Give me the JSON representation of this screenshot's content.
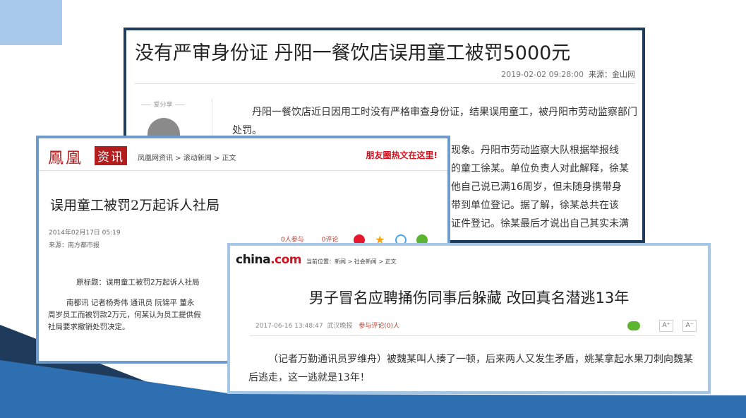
{
  "colors": {
    "accent_light": "#a9c9ea",
    "accent_dark": "#1f3b5c",
    "ifeng_red": "#b31d1d"
  },
  "panel1": {
    "title": "没有严审身份证 丹阳一餐饮店误用童工被罚5000元",
    "datetime": "2019-02-02 09:28:00",
    "source_label": "来源：金山网",
    "share_label": "爱分享",
    "share_icon": "wechat-icon",
    "paragraphs": [
      "丹阳一餐饮店近日因用工时没有严格审查身份证，结果误用童工，被丹阳市劳动监察部门处罚。",
      "现象。丹阳市劳动监察大队根据举报线",
      "的童工徐某。单位负责人对此解释，徐某",
      "他自己说已满16周岁，但未随身携带身",
      "带到单位登记。据了解，徐某总共在该",
      "证件登记。徐某最后才说出自己其实未满"
    ]
  },
  "panel2": {
    "logo_text": "鳳凰",
    "logo_box": "资讯",
    "breadcrumb": "凤凰网资讯 > 滚动新闻 > 正文",
    "promo": "朋友圈热文在这里!",
    "title": "误用童工被罚2万起诉人社局",
    "date": "2014年02月17日 05:19",
    "source": "来源：南方都市报",
    "likes": "0人参与",
    "comments": "0评论",
    "paragraphs": [
      "原标题：误用童工被罚2万起诉人社局",
      "南都讯 记者杨秀伟 通讯员 阮锦平 董永",
      "周岁员工而被罚款2万元，何某认为员工提供假",
      "社局要求撤销处罚决定。"
    ]
  },
  "panel3": {
    "logo": "china",
    "logo_suffix": ".com",
    "breadcrumb": "当前位置：新闻 > 社会新闻 > 正文",
    "title": "男子冒名应聘捅伤同事后躲藏 改回真名潜逃13年",
    "datetime": "2017-06-16 13:48:47",
    "source": "武汉晚报",
    "comments": "参与评论(0)人",
    "font_plus": "A⁺",
    "font_minus": "A⁻",
    "body": "（记者万勤通讯员罗维舟）被魏某叫人揍了一顿，后来两人又发生矛盾，姚某拿起水果刀刺向魏某后逃走，这一逃就是13年！"
  }
}
